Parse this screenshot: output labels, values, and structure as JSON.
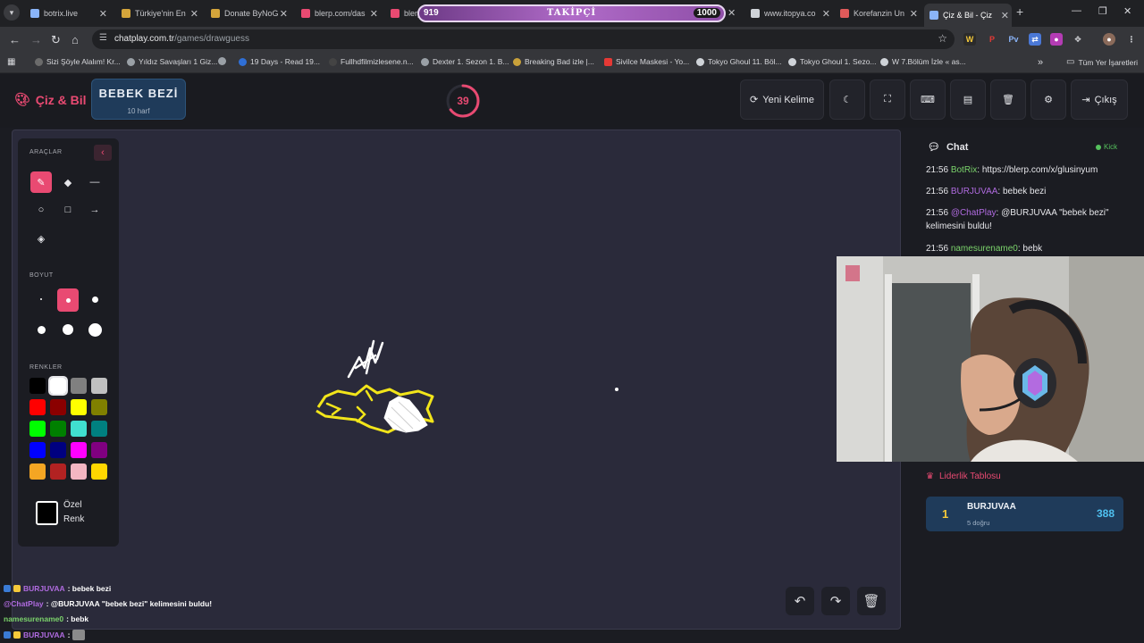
{
  "browser": {
    "tabs": [
      {
        "label": "botrix.live",
        "color": "#8ab4f8"
      },
      {
        "label": "Türkiye'nin En",
        "color": "#d4a53b"
      },
      {
        "label": "Donate ByNoG",
        "color": "#d4a53b"
      },
      {
        "label": "blerp.com/das",
        "color": "#e94a72"
      },
      {
        "label": "blerp",
        "color": "#e94a72"
      },
      {
        "label": "www.itopya.co",
        "color": "#cfd3d8"
      },
      {
        "label": "Korefanzin Un",
        "color": "#e05a5a"
      },
      {
        "label": "Çiz & Bil - Çiz",
        "color": "#8ab4f8",
        "active": true
      }
    ],
    "follow_overlay": {
      "current": "919",
      "label": "TAKİPÇİ",
      "goal": "1000"
    },
    "url_host": "chatplay.com.tr",
    "url_path": "/games/drawguess",
    "bookmarks": [
      {
        "label": "Sizi Şöyle Alalım! Kr...",
        "color": "#6b6b6b"
      },
      {
        "label": "Yıldız Savaşları 1 Giz...",
        "color": "#9aa0a6"
      },
      {
        "label": "",
        "color": "#9aa0a6"
      },
      {
        "label": "19 Days - Read 19...",
        "color": "#2f6fd6"
      },
      {
        "label": "Fullhdfilmizlesene.n...",
        "color": "#444"
      },
      {
        "label": "Dexter 1. Sezon 1. B...",
        "color": "#9aa0a6"
      },
      {
        "label": "Breaking Bad izle |...",
        "color": "#c9a13a"
      },
      {
        "label": "Sivilce Maskesi - Yo...",
        "color": "#e53935"
      },
      {
        "label": "Tokyo Ghoul 11. Böl...",
        "color": "#cfd3d8"
      },
      {
        "label": "Tokyo Ghoul 1. Sezo...",
        "color": "#cfd3d8"
      },
      {
        "label": "W 7.Bölüm İzle « as...",
        "color": "#cfd3d8"
      }
    ],
    "all_bookmarks": "Tüm Yer İşaretleri"
  },
  "game": {
    "brand": "Çiz & Bil",
    "word": "BEBEK BEZİ",
    "word_count": "10 harf",
    "timer": "39",
    "timer_fraction": 0.65,
    "buttons": {
      "new_word": "Yeni Kelime",
      "exit": "Çıkış"
    },
    "tools": {
      "section_tools": "ARAÇLAR",
      "section_size": "BOYUT",
      "section_colors": "RENKLER",
      "custom_color_1": "Özel",
      "custom_color_2": "Renk"
    },
    "colors": [
      "#000000",
      "#ffffff",
      "#808080",
      "#c0c0c0",
      "#ff0000",
      "#8b0000",
      "#ffff00",
      "#808000",
      "#00ff00",
      "#008000",
      "#40e0d0",
      "#008080",
      "#0000ff",
      "#000080",
      "#ff00ff",
      "#800080",
      "#f5a623",
      "#b22222",
      "#f4b6c2",
      "#ffd700"
    ]
  },
  "chat": {
    "title": "Chat",
    "platform": "Kick",
    "messages": [
      {
        "time": "21:56",
        "user": "BotRix",
        "user_color": "#7bd36b",
        "text": ": https://blerp.com/x/glusinyum"
      },
      {
        "time": "21:56",
        "user": "BURJUVAA",
        "user_color": "#b06be0",
        "text": ": bebek bezi"
      },
      {
        "time": "21:56",
        "user": "@ChatPlay",
        "user_color": "#b06be0",
        "text": ": @BURJUVAA \"bebek bezi\" kelimesini buldu!"
      },
      {
        "time": "21:56",
        "user": "namesurename0",
        "user_color": "#7bd36b",
        "text": ": bebk"
      }
    ]
  },
  "leaderboard": {
    "title": "Liderlik Tablosu",
    "rows": [
      {
        "rank": "1",
        "name": "BURJUVAA",
        "sub": "5 doğru",
        "score": "388"
      }
    ]
  },
  "overlay_chat": [
    {
      "user": "BURJUVAA",
      "user_color": "#b06be0",
      "text": ": bebek bezi",
      "badges": true
    },
    {
      "user": "@ChatPlay",
      "user_color": "#b06be0",
      "text": ": @BURJUVAA \"bebek bezi\" kelimesini buldu!",
      "badges": false
    },
    {
      "user": "namesurename0",
      "user_color": "#7bd36b",
      "text": ": bebk",
      "badges": false
    },
    {
      "user": "BURJUVAA",
      "user_color": "#b06be0",
      "text": ":",
      "badges": true
    }
  ]
}
